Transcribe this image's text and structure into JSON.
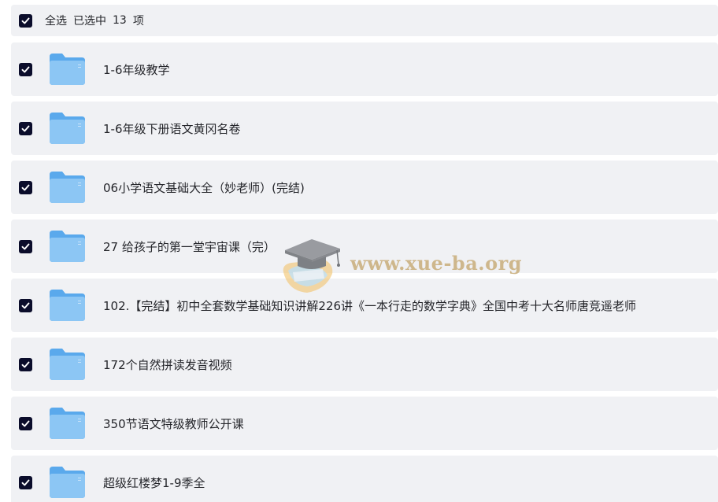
{
  "header": {
    "select_all_label": "全选",
    "selected_prefix": "已选中",
    "selected_count": "13",
    "selected_suffix": "项"
  },
  "items": [
    {
      "name": "1-6年级教学",
      "checked": true
    },
    {
      "name": "1-6年级下册语文黄冈名卷",
      "checked": true
    },
    {
      "name": "06小学语文基础大全（妙老师）(完结)",
      "checked": true
    },
    {
      "name": "27 给孩子的第一堂宇宙课（完）",
      "checked": true
    },
    {
      "name": "102.【完结】初中全套数学基础知识讲解226讲《一本行走的数学字典》全国中考十大名师唐竞遥老师",
      "checked": true
    },
    {
      "name": "172个自然拼读发音视频",
      "checked": true
    },
    {
      "name": "350节语文特级教师公开课",
      "checked": true
    },
    {
      "name": "超级红楼梦1-9季全",
      "checked": true
    }
  ],
  "watermark": {
    "text": "www.xue-ba.org"
  },
  "colors": {
    "row_background": "#f0f1f4",
    "checkbox_fill": "#0b0d2b",
    "folder_blue": "#5aa9ec",
    "watermark_gold": "#c9ad7a"
  }
}
